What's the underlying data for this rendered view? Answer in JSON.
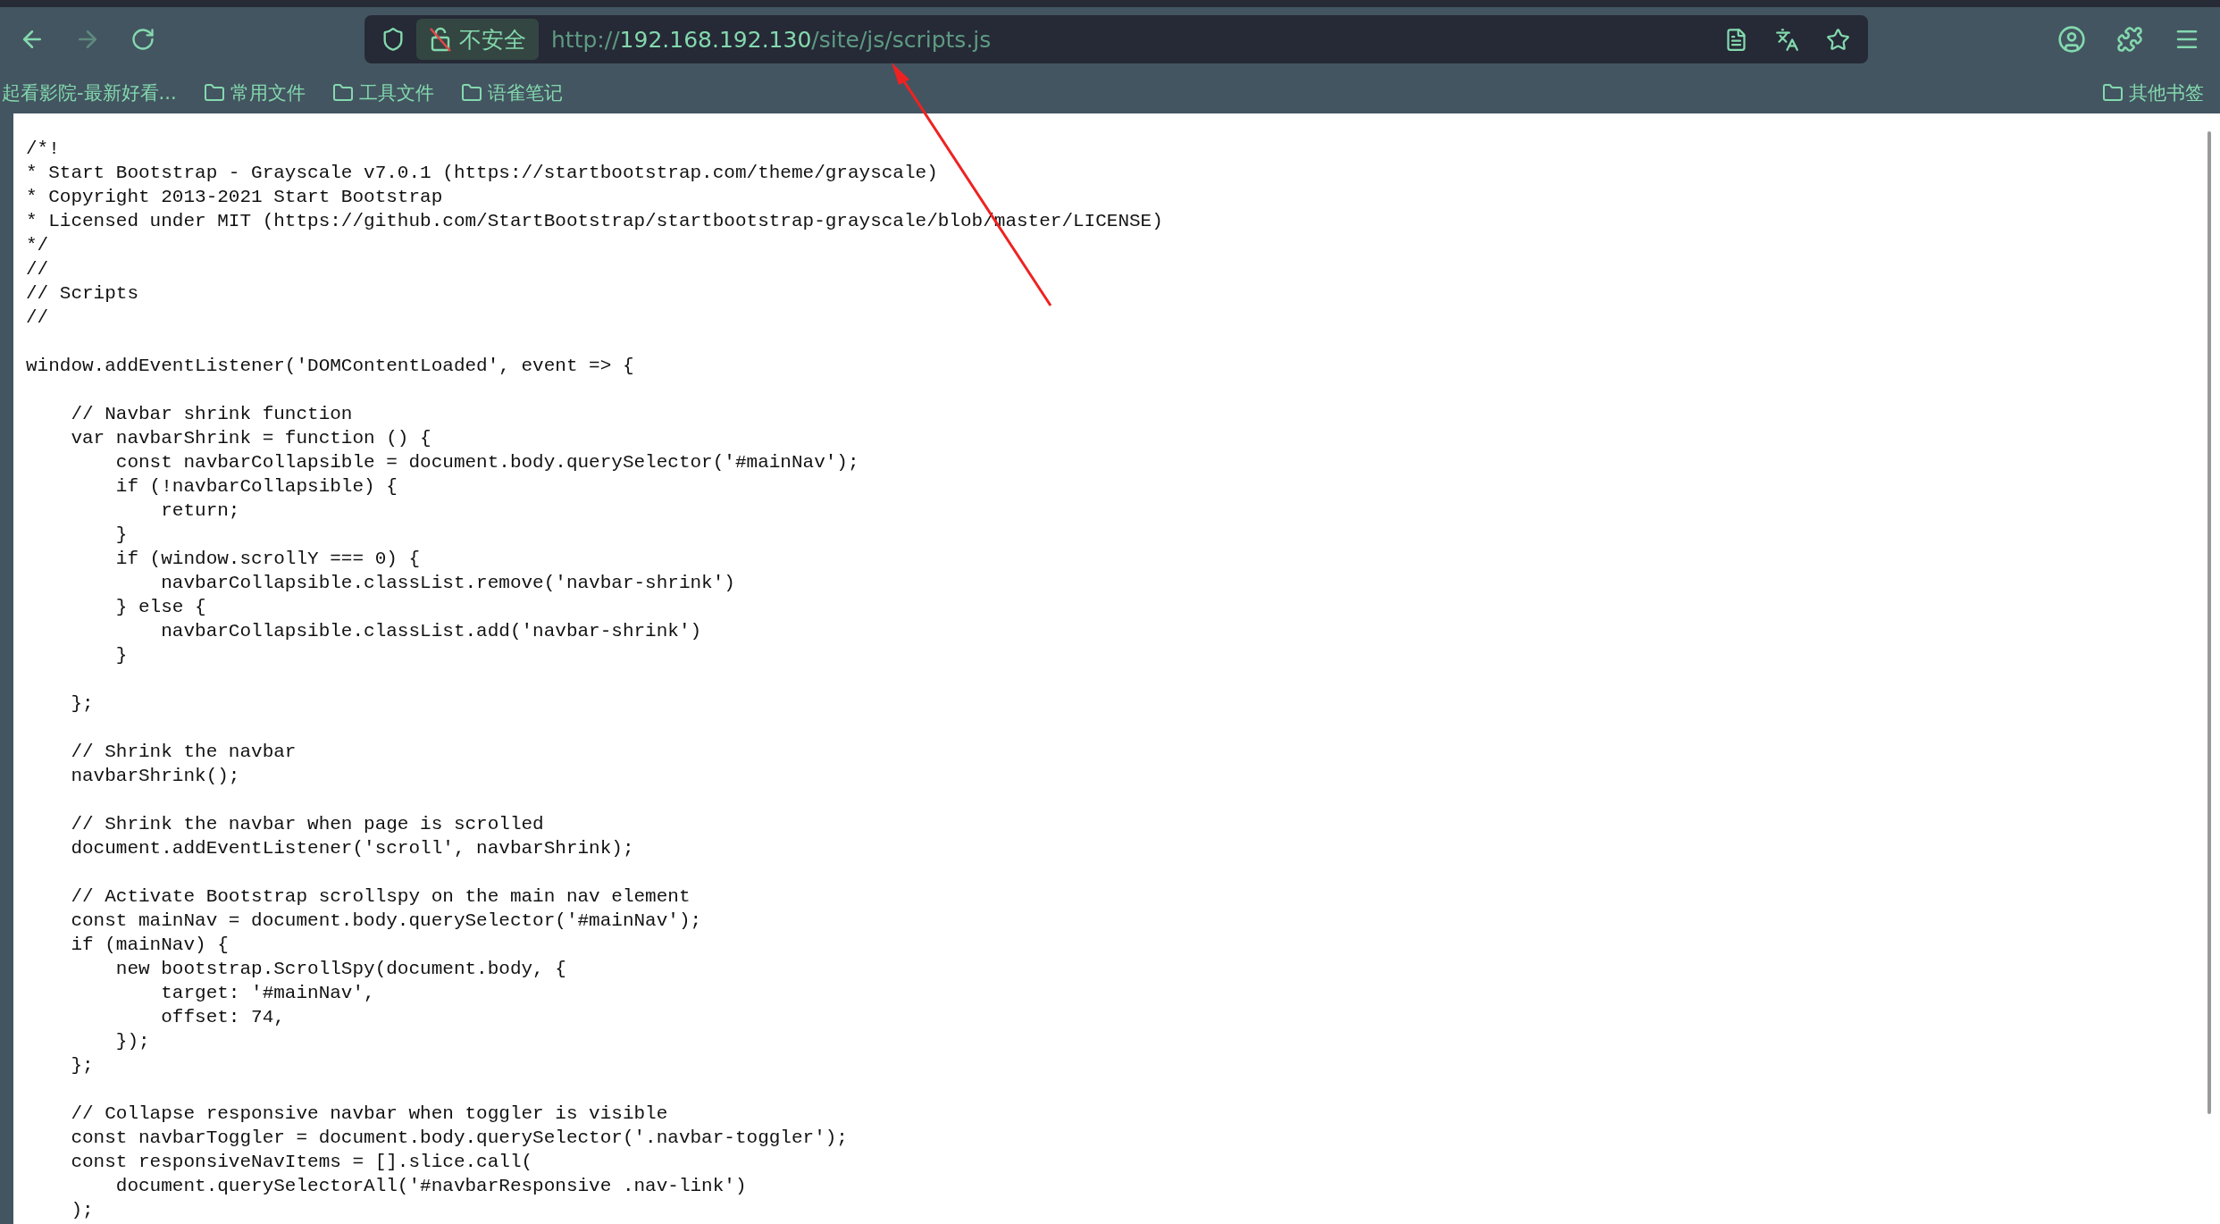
{
  "toolbar": {
    "nav_buttons": [
      {
        "kind": "back",
        "disabled": false
      },
      {
        "kind": "forward",
        "disabled": true
      },
      {
        "kind": "reload",
        "disabled": false
      }
    ],
    "security_chip": {
      "label": "不安全"
    },
    "url": {
      "scheme": "http://",
      "host": "192.168.192.130",
      "path": "/site/js/scripts.js"
    }
  },
  "bookmarks": {
    "items": [
      {
        "label": "起看影院-最新好看...",
        "kind": "page"
      },
      {
        "label": "常用文件",
        "kind": "folder"
      },
      {
        "label": "工具文件",
        "kind": "folder"
      },
      {
        "label": "语雀笔记",
        "kind": "folder"
      }
    ],
    "other": {
      "label": "其他书签"
    }
  },
  "code_blocks": [
    [
      "/*!",
      "* Start Bootstrap - Grayscale v7.0.1 (https://startbootstrap.com/theme/grayscale)",
      "* Copyright 2013-2021 Start Bootstrap",
      "* Licensed under MIT (https://github.com/StartBootstrap/startbootstrap-grayscale/blob/master/LICENSE)",
      "*/",
      "//",
      "// Scripts",
      "//"
    ],
    [
      "window.addEventListener('DOMContentLoaded', event => {"
    ],
    [
      "    // Navbar shrink function",
      "    var navbarShrink = function () {",
      "        const navbarCollapsible = document.body.querySelector('#mainNav');",
      "        if (!navbarCollapsible) {",
      "            return;",
      "        }",
      "        if (window.scrollY === 0) {",
      "            navbarCollapsible.classList.remove('navbar-shrink')",
      "        } else {",
      "            navbarCollapsible.classList.add('navbar-shrink')",
      "        }"
    ],
    [
      "    };"
    ],
    [
      "    // Shrink the navbar",
      "    navbarShrink();"
    ],
    [
      "    // Shrink the navbar when page is scrolled",
      "    document.addEventListener('scroll', navbarShrink);"
    ],
    [
      "    // Activate Bootstrap scrollspy on the main nav element",
      "    const mainNav = document.body.querySelector('#mainNav');",
      "    if (mainNav) {",
      "        new bootstrap.ScrollSpy(document.body, {",
      "            target: '#mainNav',",
      "            offset: 74,",
      "        });",
      "    };"
    ],
    [
      "    // Collapse responsive navbar when toggler is visible",
      "    const navbarToggler = document.body.querySelector('.navbar-toggler');",
      "    const responsiveNavItems = [].slice.call(",
      "        document.querySelectorAll('#navbarResponsive .nav-link')",
      "    );"
    ]
  ]
}
